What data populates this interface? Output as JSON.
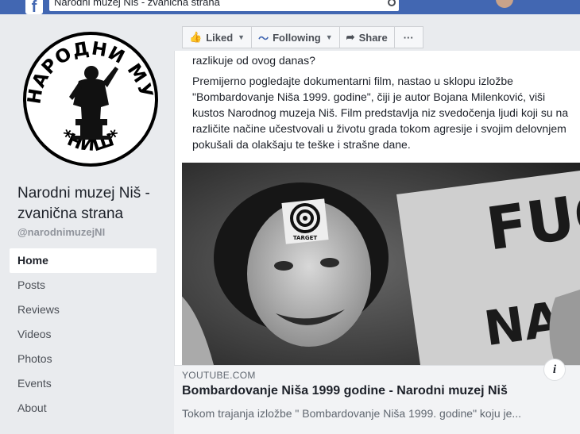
{
  "browser": {
    "search_value": "Narodni muzej Niš - zvanična strana"
  },
  "sidebar": {
    "logo_top_text": "НАРОДНИ МУЗЕЈ",
    "logo_bottom_text": "*НИШ*",
    "page_name": "Narodni muzej Niš - zvanična strana",
    "handle": "@narodnimuzejNI",
    "nav": [
      {
        "label": "Home"
      },
      {
        "label": "Posts"
      },
      {
        "label": "Reviews"
      },
      {
        "label": "Videos"
      },
      {
        "label": "Photos"
      },
      {
        "label": "Events"
      },
      {
        "label": "About"
      }
    ]
  },
  "actions": {
    "liked": "Liked",
    "following": "Following",
    "share": "Share",
    "more": "···"
  },
  "post": {
    "text_cut": "razlikuje od ovog danas?",
    "text_main": "Premijerno pogledajte dokumentarni film, nastao u sklopu izložbe \"Bombardovanje Niša 1999. godine\", čiji je autor Bojana Milenković, viši kustos Narodnog muzeja Niš. Film predstavlja niz svedočenja ljudi koji su na različite načine učestvovali u životu grada tokom agresije i svojim delovnjem pokušali da olakšaju te teške i strašne dane."
  },
  "video": {
    "badge_text": "TARGET",
    "sign_text": "FUC",
    "sign_text_2": "NATO"
  },
  "link_preview": {
    "domain": "YOUTUBE.COM",
    "title": "Bombardovanje Niša 1999 godine - Narodni muzej Niš",
    "description": "Tokom trajanja izložbe \" Bombardovanje Niša 1999. godine\" koju je..."
  }
}
